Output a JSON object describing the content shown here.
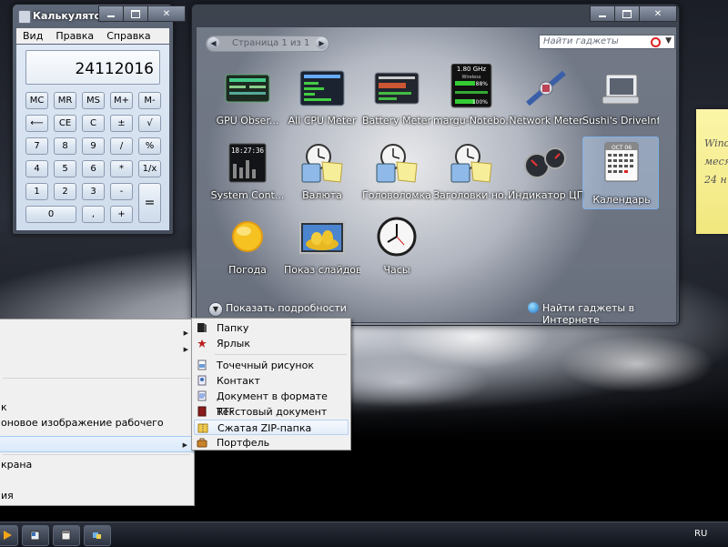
{
  "calculator": {
    "title": "Калькулятор",
    "menu": [
      "Вид",
      "Правка",
      "Справка"
    ],
    "display": "24112016",
    "keys": {
      "mc": "MC",
      "mr": "MR",
      "ms": "MS",
      "mplus": "M+",
      "mminus": "M-",
      "back": "⟵",
      "ce": "CE",
      "c": "C",
      "plusminus": "±",
      "sqrt": "√",
      "n7": "7",
      "n8": "8",
      "n9": "9",
      "div": "/",
      "pct": "%",
      "n4": "4",
      "n5": "5",
      "n6": "6",
      "mul": "*",
      "inv": "1/x",
      "n1": "1",
      "n2": "2",
      "n3": "3",
      "minus": "-",
      "n0": "0",
      "dot": ",",
      "plus": "+",
      "eq": "="
    }
  },
  "gadgets_window": {
    "pager_label": "Страница 1 из 1",
    "search_placeholder": "Найти гаджеты",
    "gadgets": [
      {
        "label": "GPU Obser...",
        "icon": "gpu-monitor-icon"
      },
      {
        "label": "All CPU Meter",
        "icon": "cpu-meter-icon"
      },
      {
        "label": "Battery Meter",
        "icon": "battery-meter-icon"
      },
      {
        "label": "margu-Notebo...",
        "icon": "notebook-info-icon"
      },
      {
        "label": "Network Meter",
        "icon": "satellite-icon"
      },
      {
        "label": "Sushi's DriveInfo",
        "icon": "drive-icon"
      },
      {
        "label": "System Cont...",
        "icon": "system-control-icon"
      },
      {
        "label": "Валюта",
        "icon": "currency-icon"
      },
      {
        "label": "Головоломка",
        "icon": "puzzle-icon"
      },
      {
        "label": "Заголовки но...",
        "icon": "news-headlines-icon"
      },
      {
        "label": "Индикатор ЦП",
        "icon": "cpu-indicator-icon"
      },
      {
        "label": "Календарь",
        "icon": "calendar-icon"
      },
      {
        "label": "Погода",
        "icon": "weather-sun-icon"
      },
      {
        "label": "Показ слайдов",
        "icon": "slideshow-icon"
      },
      {
        "label": "Часы",
        "icon": "clock-icon"
      }
    ],
    "calendar_month": "ОСТ 06",
    "cpu_gadget": {
      "freq": "1.80 GHz",
      "wireless": "Wireless",
      "signal": "88%",
      "charge": "100%"
    },
    "system_gadget_time": "18:27:36",
    "show_details": "Показать подробности",
    "online_link": "Найти гаджеты в Интернете"
  },
  "sticky_note": {
    "lines": [
      "Wind",
      "меся",
      "24 н"
    ]
  },
  "context_menu": {
    "items": [
      {
        "label": "",
        "submenu": true
      },
      {
        "label": "",
        "submenu": true
      },
      {
        "label": "к"
      },
      {
        "label": "оновое изображение рабочего стола"
      },
      {
        "label": "",
        "submenu": true
      },
      {
        "label": "крана"
      },
      {
        "label": "ия"
      }
    ]
  },
  "new_submenu": {
    "items": [
      {
        "label": "Папку",
        "icon": "folder-icon"
      },
      {
        "label": "Ярлык",
        "icon": "shortcut-icon"
      },
      {
        "label": "Точечный рисунок",
        "icon": "bitmap-icon"
      },
      {
        "label": "Контакт",
        "icon": "contact-icon"
      },
      {
        "label": "Документ в формате RTF",
        "icon": "rtf-document-icon"
      },
      {
        "label": "Текстовый документ",
        "icon": "text-document-icon"
      },
      {
        "label": "Сжатая ZIP-папка",
        "icon": "zip-folder-icon"
      },
      {
        "label": "Портфель",
        "icon": "briefcase-icon"
      }
    ]
  },
  "taskbar": {
    "language": "RU",
    "buttons": [
      "media-player-icon",
      "explorer-icon",
      "calculator-icon",
      "gadgets-icon"
    ]
  },
  "colors": {
    "selection": "#cfe3fb",
    "accent": "#1c74c8"
  }
}
